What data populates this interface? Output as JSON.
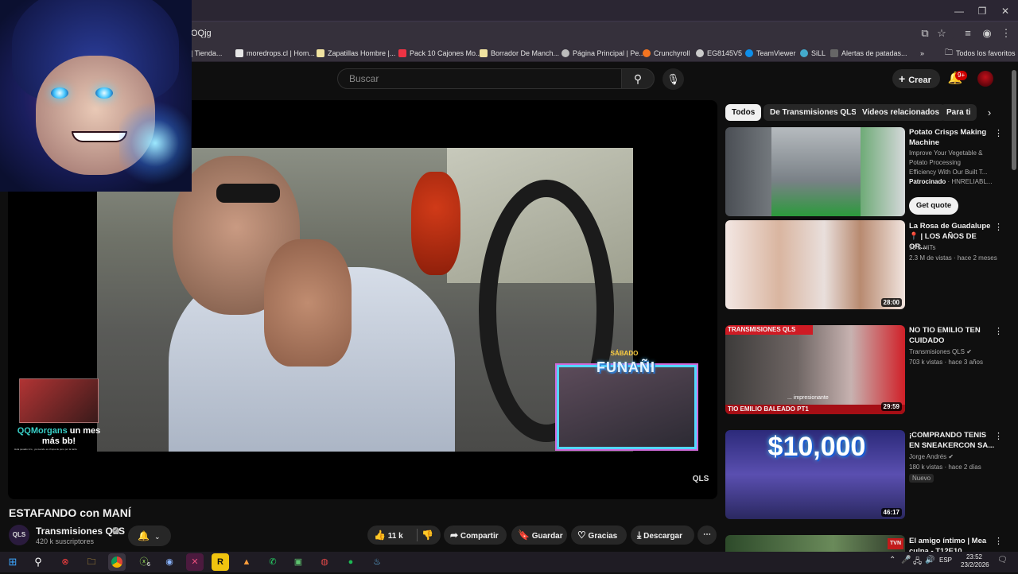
{
  "browser": {
    "url_fragment": "OQjg",
    "bookmarks": [
      {
        "label": "| Tienda...",
        "color": "#777"
      },
      {
        "label": "moredrops.cl | Hom...",
        "color": "#e6e6e6"
      },
      {
        "label": "Zapatillas Hombre |...",
        "color": "#f0e2a0"
      },
      {
        "label": "Pack 10 Cajones Mo...",
        "color": "#e34"
      },
      {
        "label": "Borrador De Manch...",
        "color": "#f0e2a0"
      },
      {
        "label": "Página Principal | Pe...",
        "color": "#bbb"
      },
      {
        "label": "Crunchyroll",
        "color": "#f47521"
      },
      {
        "label": "EG8145V5",
        "color": "#ccc"
      },
      {
        "label": "TeamViewer",
        "color": "#0e8ee9"
      },
      {
        "label": "SiLL",
        "color": "#4ac"
      },
      {
        "label": "Alertas de patadas...",
        "color": "#666"
      }
    ],
    "bookmarks_overflow": "»",
    "all_favorites": "Todos los favoritos"
  },
  "header": {
    "search_placeholder": "Buscar",
    "create_label": "Crear",
    "notifications_badge": "9+"
  },
  "player": {
    "overlay_user": "QQMorgans",
    "overlay_msg1": " un mes",
    "overlay_msg2": "más bb!",
    "overlay_fine": "Hola pesado rico , ya cuando es chupa de pero por la tarde",
    "funa_top": "SÁBADO",
    "funa_title": "FUNAÑI",
    "qls_logo": "QLS"
  },
  "video": {
    "title": "ESTAFANDO con MANÍ",
    "channel": "Transmisiones QLS",
    "channel_avatar_text": "QLS",
    "subscribers": "420 k suscriptores",
    "likes": "11 k",
    "actions": {
      "share": "Compartir",
      "save": "Guardar",
      "thanks": "Gracias",
      "download": "Descargar"
    }
  },
  "chips": [
    "Todos",
    "De Transmisiones QLS",
    "Videos relacionados",
    "Para ti"
  ],
  "recommendations": [
    {
      "title": "Potato Crisps Making Machine",
      "desc": "Improve Your Vegetable & Potato Processing Efficiency With Our Built T...",
      "sponsored": "Patrocinado",
      "advertiser": "HNRELIABL...",
      "cta": "Get quote"
    },
    {
      "title": "La Rosa de Guadalupe 📍 | LOS AÑOS DE OR...",
      "channel": "90'S HiTs",
      "meta": "2.3 M de vistas · hace 2 meses",
      "duration": "28:00"
    },
    {
      "title": "NO TIO EMILIO TEN CUIDADO",
      "channel": "Transmisiones QLS",
      "meta": "703 k vistas · hace 3 años",
      "duration": "29:59",
      "thumb_text": "TIO EMILIO BALEADO PT1",
      "thumb_caption": "... impresionante"
    },
    {
      "title": "¡COMPRANDO TENIS EN SNEAKERCON SA...",
      "channel": "Jorge Andrés",
      "meta": "180 k vistas · hace 2 días",
      "badge": "Nuevo",
      "duration": "46:17",
      "thumb_text": "$10,000"
    },
    {
      "title": "El amigo íntimo | Mea culpa - T12E10",
      "thumb_text": "TVN"
    }
  ],
  "taskbar": {
    "lang": "ESP",
    "time": "23:52",
    "date": "23/2/2026",
    "xbox_badge": "6"
  }
}
